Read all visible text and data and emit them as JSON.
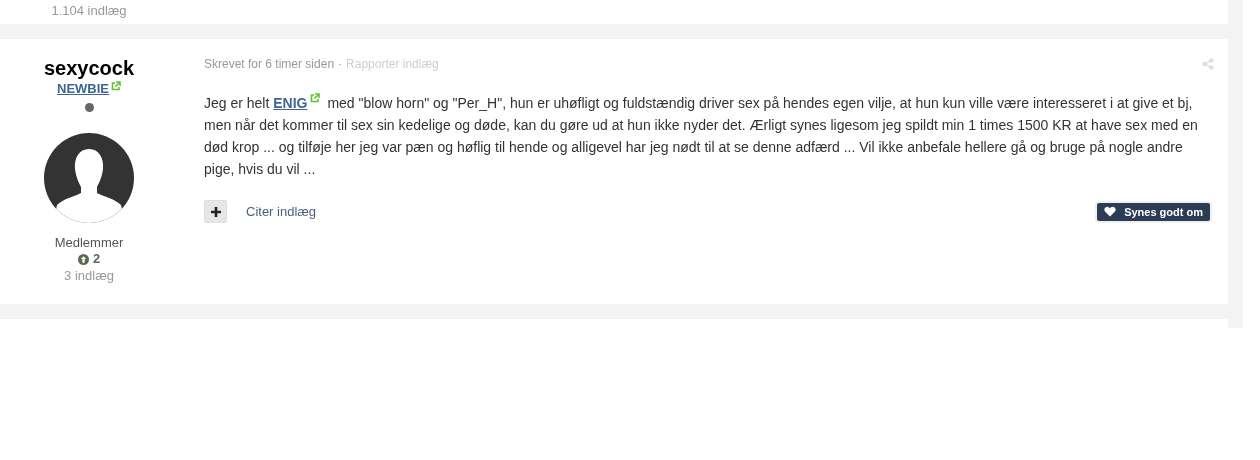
{
  "previous_post": {
    "post_count": "1.104 indlæg"
  },
  "post": {
    "author": {
      "name": "sexycock",
      "rank": "NEWBIE",
      "online": false,
      "group": "Medlemmer",
      "reputation": "2",
      "post_count": "3 indlæg"
    },
    "meta": {
      "time": "Skrevet for 6 timer siden",
      "separator": "·",
      "report": "Rapporter indlæg"
    },
    "body": {
      "before": "Jeg er helt",
      "link": "ENIG",
      "after": "med \"blow horn\" og \"Per_H\", hun er uhøfligt og fuldstændig driver sex på hendes egen vilje, at hun kun ville være interesseret i at give et bj, men når det kommer til sex sin kedelige og døde, kan du gøre ud at hun ikke nyder det. Ærligt synes ligesom jeg spildt min 1 times 1500 KR at have sex med en død krop ... og tilføje her jeg var pæn og høflig til hende og alligevel har jeg nødt til at se denne adfærd ... Vil ikke anbefale hellere gå og bruge på nogle andre pige, hvis du vil ..."
    },
    "actions": {
      "quote": "Citer indlæg",
      "like": "Synes godt om"
    }
  }
}
